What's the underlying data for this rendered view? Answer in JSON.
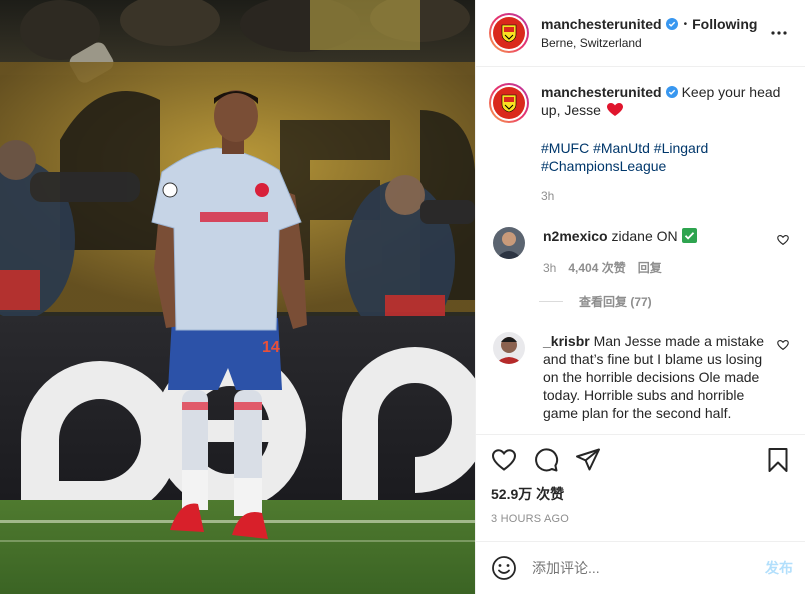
{
  "header": {
    "username": "manchesterunited",
    "follow_state": "Following",
    "location": "Berne, Switzerland",
    "dot": "•"
  },
  "caption": {
    "username": "manchesterunited",
    "text": "Keep your head up, Jesse",
    "emoji": "heart",
    "hashtags": "#MUFC #ManUtd #Lingard #ChampionsLeague",
    "time": "3h"
  },
  "comments": [
    {
      "username": "n2mexico",
      "text": "zidane ON",
      "emoji": "check-mark",
      "time": "3h",
      "likes": "4,404 次赞",
      "reply": "回复",
      "view_replies": "查看回复 (77)"
    },
    {
      "username": "_krisbr",
      "text": "Man Jesse made a mistake and that’s fine but I blame us losing on the horrible decisions Ole made today. Horrible subs and horrible game plan for the second half."
    }
  ],
  "footer": {
    "likes": "52.9万 次赞",
    "timestamp": "3 HOURS AGO",
    "comment_placeholder": "添加评论...",
    "post_label": "发布"
  },
  "colors": {
    "link": "#00376b",
    "muted": "#8e8e8e",
    "verified": "#3897f0",
    "heart": "#ed4956",
    "post_disabled": "#b2dffc",
    "united_red": "#da291c"
  }
}
